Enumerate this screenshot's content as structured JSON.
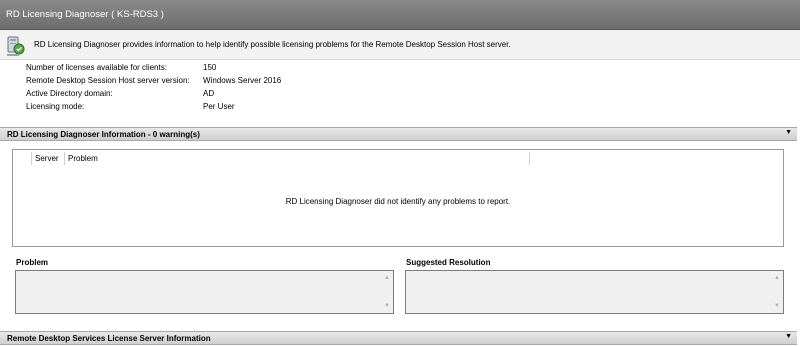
{
  "window": {
    "title": "RD Licensing Diagnoser ( KS-RDS3 )"
  },
  "intro": {
    "icon": "computer-license-icon",
    "text": "RD Licensing Diagnoser provides information to help identify possible licensing problems for the Remote Desktop Session Host server."
  },
  "info": [
    {
      "label": "Number of licenses available for clients:",
      "value": "150"
    },
    {
      "label": "Remote Desktop Session Host server version:",
      "value": "Windows Server 2016"
    },
    {
      "label": "Active Directory domain:",
      "value": "AD"
    },
    {
      "label": "Licensing mode:",
      "value": "Per User"
    }
  ],
  "diag_section": {
    "title": "RD Licensing Diagnoser Information - 0 warning(s)",
    "chevron_icon": "chevron-down-icon",
    "columns": [
      "Server",
      "Problem"
    ],
    "empty_message": "RD Licensing Diagnoser did not identify any problems to report."
  },
  "problem_pane": {
    "label": "Problem",
    "value": ""
  },
  "resolution_pane": {
    "label": "Suggested Resolution",
    "value": ""
  },
  "license_server_section": {
    "title": "Remote Desktop Services License Server Information",
    "chevron_icon": "chevron-down-icon"
  },
  "glyphs": {
    "chevron": "▼",
    "scroll_up": "▲",
    "scroll_down": "▼"
  }
}
